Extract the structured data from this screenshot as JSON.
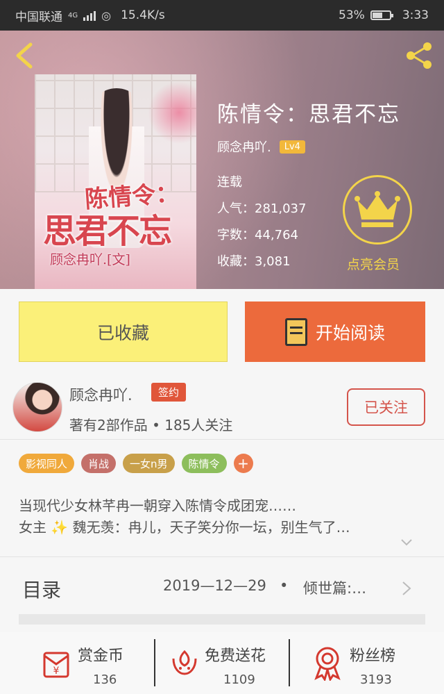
{
  "status": {
    "carrier": "中国联通",
    "net_type": "4G",
    "speed": "15.4K/s",
    "battery": "53%",
    "time": "3:33"
  },
  "book": {
    "title": "陈情令：思君不忘",
    "author": "顾念冉吖.",
    "level": "Lv4",
    "state": "连载",
    "popularity": "人气：281,037",
    "words": "字数：44,764",
    "favorites": "收藏：3,081",
    "vip_label": "点亮会员",
    "cover": {
      "title_line1": "陈情令：",
      "title_line2": "思君不忘",
      "author_line": "顾念冉吖.[文]"
    }
  },
  "actions": {
    "favorited_label": "已收藏",
    "read_label": "开始阅读"
  },
  "author_info": {
    "name": "顾念冉吖.",
    "badge": "签约",
    "works": "著有2部作品 • 185人关注",
    "follow_label": "已关注"
  },
  "tags": [
    {
      "label": "影视同人",
      "color": "#f0a93b"
    },
    {
      "label": "肖战",
      "color": "#c4706a"
    },
    {
      "label": "一女n男",
      "color": "#c8a04a"
    },
    {
      "label": "陈情令",
      "color": "#8dbe5c"
    }
  ],
  "tag_add_label": "+",
  "synopsis": {
    "line1": "当现代少女林芊冉一朝穿入陈情令成团宠……",
    "line2_prefix": "女主",
    "line2_rest": "魏无羡：冉儿，天子笑分你一坛，别生气了…"
  },
  "catalog": {
    "title": "目录",
    "date": "2019—12—29",
    "dot": "•",
    "latest": "倾世篇:…"
  },
  "bottom": [
    {
      "label": "赏金币",
      "count": "136",
      "icon": "gift-envelope-icon"
    },
    {
      "label": "免费送花",
      "count": "1109",
      "icon": "flower-icon"
    },
    {
      "label": "粉丝榜",
      "count": "3193",
      "icon": "medal-icon"
    }
  ],
  "colors": {
    "accent": "#ec6a3c",
    "fav_button": "#fbf079",
    "vip_gold": "#f3d44a",
    "follow_red": "#d4544b"
  }
}
